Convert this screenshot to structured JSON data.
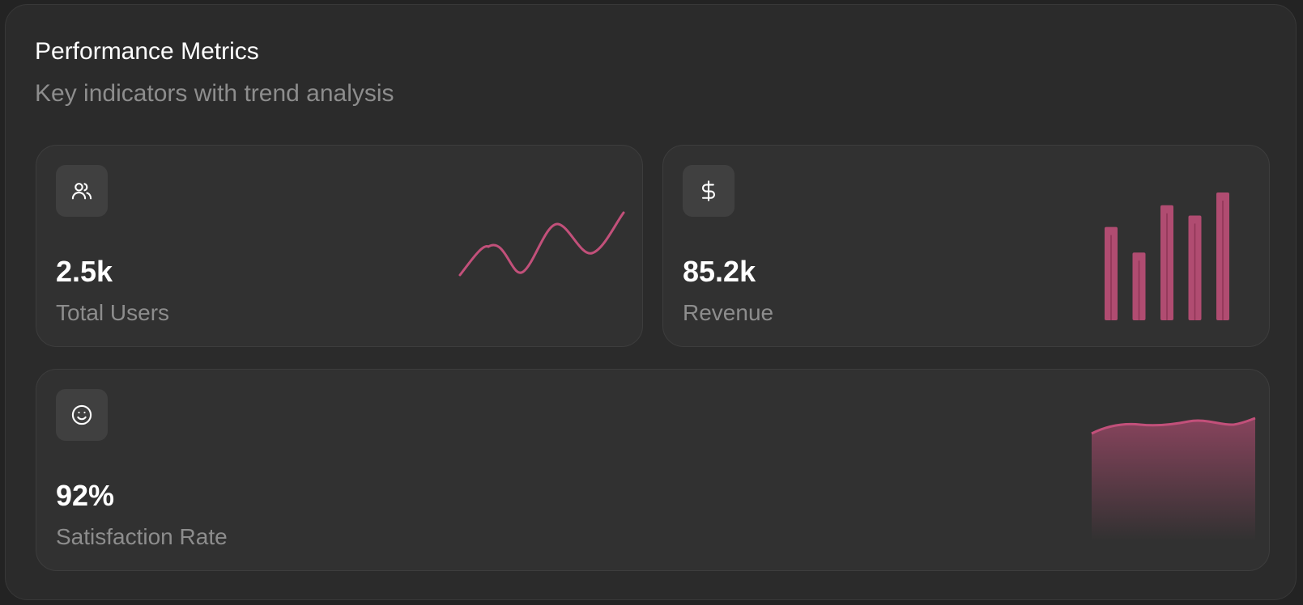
{
  "header": {
    "title": "Performance Metrics",
    "subtitle": "Key indicators with trend analysis"
  },
  "colors": {
    "accent": "#c2507a",
    "panel_bg": "#2b2b2b",
    "card_bg": "#313131",
    "icon_tile_bg": "#404040",
    "text_primary": "#ffffff",
    "text_muted": "#8d8d8d"
  },
  "metrics": [
    {
      "value": "2.5k",
      "label": "Total Users",
      "icon": "users-icon",
      "sparkline": {
        "type": "line",
        "values": [
          0.15,
          0.55,
          0.2,
          0.7,
          0.3,
          1.0
        ]
      }
    },
    {
      "value": "85.2k",
      "label": "Revenue",
      "icon": "dollar-icon",
      "sparkline": {
        "type": "bar",
        "values": [
          0.73,
          0.53,
          0.9,
          0.82,
          1.0
        ]
      }
    },
    {
      "value": "92%",
      "label": "Satisfaction Rate",
      "icon": "smile-icon",
      "sparkline": {
        "type": "area",
        "values": [
          0.9,
          0.99,
          0.97,
          0.99,
          0.96,
          1.0
        ]
      }
    }
  ]
}
